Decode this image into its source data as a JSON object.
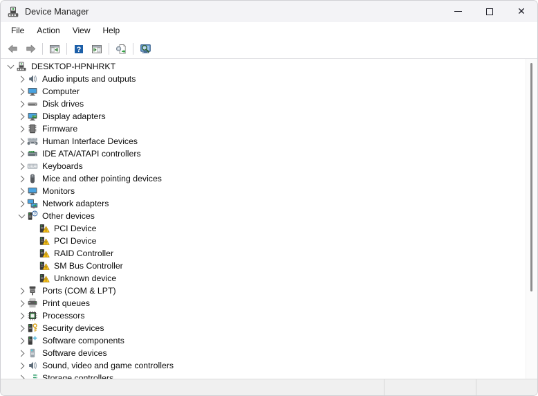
{
  "window": {
    "title": "Device Manager",
    "icon": "device-manager-icon",
    "caption_buttons": [
      {
        "name": "minimize-button",
        "label": "—"
      },
      {
        "name": "maximize-button",
        "label": "□"
      },
      {
        "name": "close-button",
        "label": "✕"
      }
    ]
  },
  "menubar": {
    "items": [
      {
        "label": "File"
      },
      {
        "label": "Action"
      },
      {
        "label": "View"
      },
      {
        "label": "Help"
      }
    ]
  },
  "toolbar": {
    "buttons": [
      {
        "name": "back-button",
        "icon": "back-arrow-icon",
        "tooltip": "Back"
      },
      {
        "name": "forward-button",
        "icon": "forward-arrow-icon",
        "tooltip": "Forward"
      },
      {
        "name": "show-hide-console-tree-button",
        "icon": "console-tree-icon",
        "tooltip": "Show/Hide Console Tree"
      },
      {
        "name": "help-button",
        "icon": "help-question-icon",
        "tooltip": "Help"
      },
      {
        "name": "properties-button",
        "icon": "properties-icon",
        "tooltip": "Properties"
      },
      {
        "name": "update-driver-button",
        "icon": "update-driver-icon",
        "tooltip": "Update driver"
      },
      {
        "name": "scan-hardware-changes-button",
        "icon": "scan-hardware-icon",
        "tooltip": "Scan for hardware changes"
      }
    ]
  },
  "tree": {
    "root": {
      "label": "DESKTOP-HPNHRKT",
      "icon": "computer-icon",
      "expanded": true
    },
    "nodes": [
      {
        "label": "Audio inputs and outputs",
        "icon": "speaker-icon",
        "expanded": false,
        "level": 1
      },
      {
        "label": "Computer",
        "icon": "monitor-icon",
        "expanded": false,
        "level": 1
      },
      {
        "label": "Disk drives",
        "icon": "disk-drive-icon",
        "expanded": false,
        "level": 1
      },
      {
        "label": "Display adapters",
        "icon": "display-adapter-icon",
        "expanded": false,
        "level": 1
      },
      {
        "label": "Firmware",
        "icon": "firmware-chip-icon",
        "expanded": false,
        "level": 1
      },
      {
        "label": "Human Interface Devices",
        "icon": "gamepad-icon",
        "expanded": false,
        "level": 1
      },
      {
        "label": "IDE ATA/ATAPI controllers",
        "icon": "ide-controller-icon",
        "expanded": false,
        "level": 1
      },
      {
        "label": "Keyboards",
        "icon": "keyboard-icon",
        "expanded": false,
        "level": 1
      },
      {
        "label": "Mice and other pointing devices",
        "icon": "mouse-icon",
        "expanded": false,
        "level": 1
      },
      {
        "label": "Monitors",
        "icon": "monitor-icon",
        "expanded": false,
        "level": 1
      },
      {
        "label": "Network adapters",
        "icon": "network-adapter-icon",
        "expanded": false,
        "level": 1
      },
      {
        "label": "Other devices",
        "icon": "unknown-device-icon",
        "expanded": true,
        "level": 1
      },
      {
        "label": "PCI Device",
        "icon": "warning-device-icon",
        "expanded": null,
        "level": 2
      },
      {
        "label": "PCI Device",
        "icon": "warning-device-icon",
        "expanded": null,
        "level": 2
      },
      {
        "label": "RAID Controller",
        "icon": "warning-device-icon",
        "expanded": null,
        "level": 2
      },
      {
        "label": "SM Bus Controller",
        "icon": "warning-device-icon",
        "expanded": null,
        "level": 2
      },
      {
        "label": "Unknown device",
        "icon": "warning-device-icon",
        "expanded": null,
        "level": 2
      },
      {
        "label": "Ports (COM & LPT)",
        "icon": "port-icon",
        "expanded": false,
        "level": 1
      },
      {
        "label": "Print queues",
        "icon": "printer-icon",
        "expanded": false,
        "level": 1
      },
      {
        "label": "Processors",
        "icon": "processor-icon",
        "expanded": false,
        "level": 1
      },
      {
        "label": "Security devices",
        "icon": "security-key-icon",
        "expanded": false,
        "level": 1
      },
      {
        "label": "Software components",
        "icon": "software-component-icon",
        "expanded": false,
        "level": 1
      },
      {
        "label": "Software devices",
        "icon": "software-device-icon",
        "expanded": false,
        "level": 1
      },
      {
        "label": "Sound, video and game controllers",
        "icon": "speaker-icon",
        "expanded": false,
        "level": 1
      },
      {
        "label": "Storage controllers",
        "icon": "storage-controller-icon",
        "expanded": false,
        "level": 1
      }
    ]
  },
  "statusbar": {
    "pane1": "",
    "pane2": "",
    "pane3": ""
  },
  "colors": {
    "titlebar_bg": "#f3f3f6",
    "window_bg": "#ffffff",
    "statusbar_bg": "#f0f0f0",
    "warning_yellow": "#ffc81e",
    "accent_green": "#2e9e3e",
    "accent_blue": "#3a86c8",
    "scrollbar_thumb": "#8d8d8d"
  }
}
